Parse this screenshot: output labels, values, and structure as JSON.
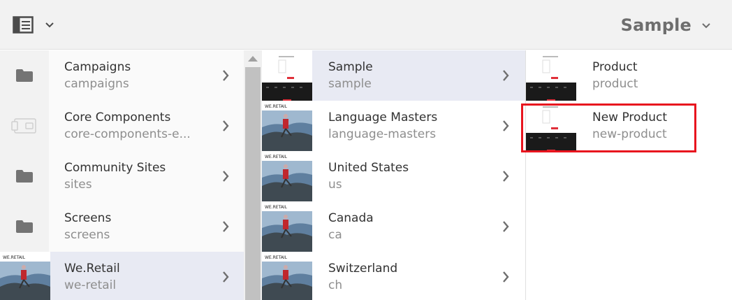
{
  "header": {
    "rail_toggle_icon": "side-panel-icon",
    "breadcrumb_title": "Sample",
    "breadcrumb_icon": "chevron-down-icon"
  },
  "columns": [
    {
      "items": [
        {
          "title": "Campaigns",
          "name": "campaigns",
          "thumb": "folder-icon",
          "selected": false
        },
        {
          "title": "Core Components",
          "name": "core-components-e...",
          "thumb": "component-icon",
          "selected": false
        },
        {
          "title": "Community Sites",
          "name": "sites",
          "thumb": "folder-icon",
          "selected": false
        },
        {
          "title": "Screens",
          "name": "screens",
          "thumb": "folder-icon",
          "selected": false
        },
        {
          "title": "We.Retail",
          "name": "we-retail",
          "thumb": "we-retail-thumbnail",
          "selected": true
        }
      ]
    },
    {
      "items": [
        {
          "title": "Sample",
          "name": "sample",
          "thumb": "page-thumbnail",
          "selected": true
        },
        {
          "title": "Language Masters",
          "name": "language-masters",
          "thumb": "we-retail-thumbnail",
          "selected": false
        },
        {
          "title": "United States",
          "name": "us",
          "thumb": "we-retail-thumbnail",
          "selected": false
        },
        {
          "title": "Canada",
          "name": "ca",
          "thumb": "we-retail-thumbnail",
          "selected": false
        },
        {
          "title": "Switzerland",
          "name": "ch",
          "thumb": "we-retail-thumbnail",
          "selected": false
        }
      ]
    },
    {
      "items": [
        {
          "title": "Product",
          "name": "product",
          "thumb": "page-thumbnail",
          "selected": false
        },
        {
          "title": "New Product",
          "name": "new-product",
          "thumb": "page-thumbnail",
          "selected": false,
          "highlighted": true
        }
      ]
    }
  ],
  "thumb_labels": {
    "we_retail": "WE.RETAIL"
  },
  "colors": {
    "selected_row": "#e8eaf3",
    "highlight": "#e8141e",
    "title_text": "#323232",
    "subtitle_text": "#8e8e8e"
  }
}
